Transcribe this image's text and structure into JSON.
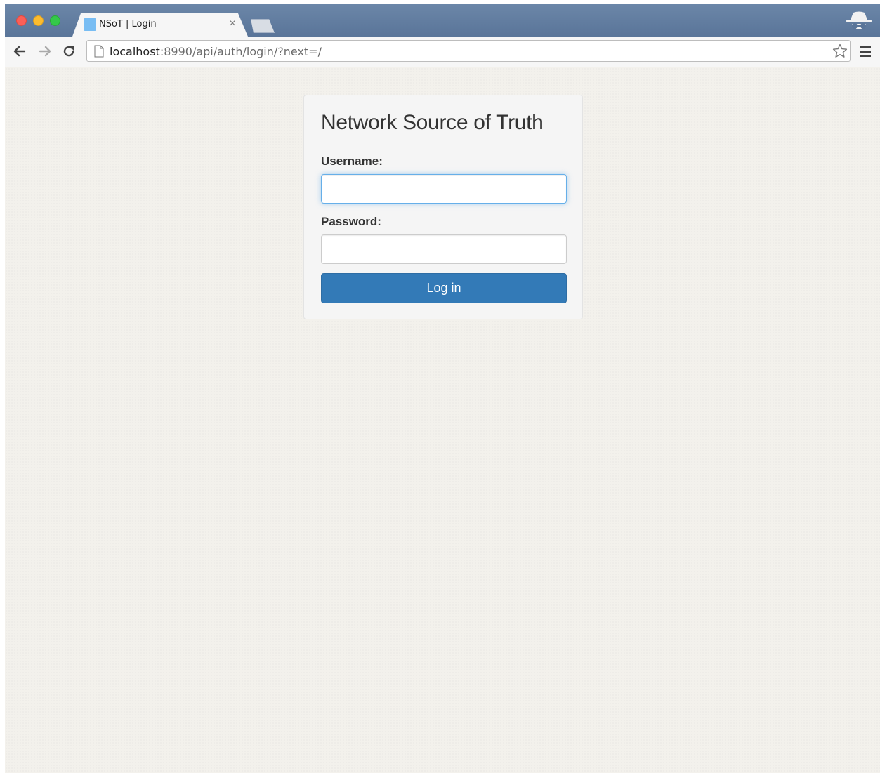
{
  "browser": {
    "tab": {
      "title": "NSoT | Login",
      "close": "×"
    },
    "url": {
      "host": "localhost",
      "path": ":8990/api/auth/login/?next=/"
    },
    "icons": [
      "back-arrow-icon",
      "forward-arrow-icon",
      "reload-icon",
      "page-icon",
      "star-icon",
      "menu-icon",
      "incognito-icon"
    ]
  },
  "login": {
    "title": "Network Source of Truth",
    "username_label": "Username:",
    "username_value": "",
    "password_label": "Password:",
    "password_value": "",
    "submit_label": "Log in"
  },
  "colors": {
    "accent": "#337ab7",
    "focus_ring": "#66afe9",
    "page_background": "#f3f1ec",
    "tabstrip": "#5a7599"
  }
}
